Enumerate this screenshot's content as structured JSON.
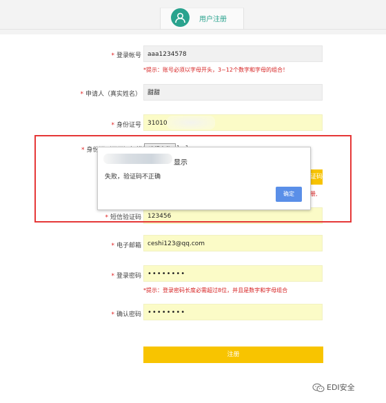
{
  "header": {
    "title": "用户注册"
  },
  "form": {
    "account": {
      "label": "登录帐号",
      "value": "aaa1234578",
      "hint": "*提示：账号必须以字母开头，3~12个数字和字母的组合！"
    },
    "applicant": {
      "label": "申请人（真实姓名）",
      "value": "甜甜"
    },
    "idcard": {
      "label": "身份证号",
      "value": "310104"
    },
    "upload": {
      "label": "身份证（正面）扫描件",
      "button": "选择文件",
      "tail": "1...1"
    },
    "get_code_button": "证码",
    "partial_hint": "册,",
    "sms": {
      "label": "短信验证码",
      "value": "123456"
    },
    "email": {
      "label": "电子邮箱",
      "value": "ceshi123@qq.com"
    },
    "password": {
      "label": "登录密码",
      "value": "••••••••",
      "hint": "*提示：登录密码长度必需超过8位，并且是数字和字母组合"
    },
    "confirm": {
      "label": "确认密码",
      "value": "••••••••"
    },
    "submit": "注册"
  },
  "dialog": {
    "title": "显示",
    "message": "失败，验证码不正确",
    "ok": "确定"
  },
  "watermark": {
    "text": "EDI安全"
  },
  "required_mark": "*",
  "colors": {
    "accent": "#2aa38e",
    "button_yellow": "#f8c400",
    "input_yellow": "#fbfbc7",
    "error_red": "#d62020",
    "dialog_blue": "#5a8fe8"
  }
}
